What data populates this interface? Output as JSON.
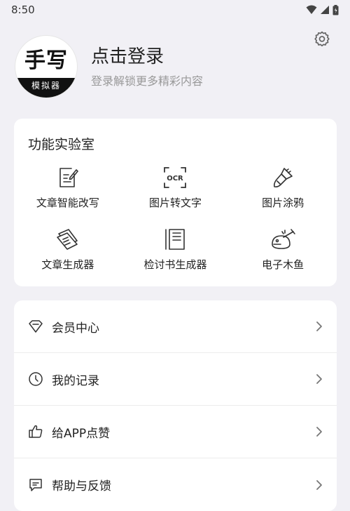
{
  "status_bar": {
    "time": "8:50"
  },
  "profile": {
    "avatar_main": "手写",
    "avatar_sub": "模拟器",
    "title": "点击登录",
    "subtitle": "登录解锁更多精彩内容"
  },
  "lab": {
    "title": "功能实验室",
    "items": [
      {
        "label": "文章智能改写",
        "icon": "edit-document-icon"
      },
      {
        "label": "图片转文字",
        "icon": "ocr-icon"
      },
      {
        "label": "图片涂鸦",
        "icon": "paint-brush-icon"
      },
      {
        "label": "文章生成器",
        "icon": "stacked-papers-icon"
      },
      {
        "label": "检讨书生成器",
        "icon": "notebook-icon"
      },
      {
        "label": "电子木鱼",
        "icon": "wooden-fish-icon"
      }
    ]
  },
  "menu": {
    "items": [
      {
        "label": "会员中心",
        "icon": "diamond-icon"
      },
      {
        "label": "我的记录",
        "icon": "clock-icon"
      },
      {
        "label": "给APP点赞",
        "icon": "thumbs-up-icon"
      },
      {
        "label": "帮助与反馈",
        "icon": "feedback-icon"
      }
    ]
  },
  "colors": {
    "background": "#f1f0f5",
    "card": "#ffffff",
    "text": "#222222",
    "subtext": "#999999"
  }
}
